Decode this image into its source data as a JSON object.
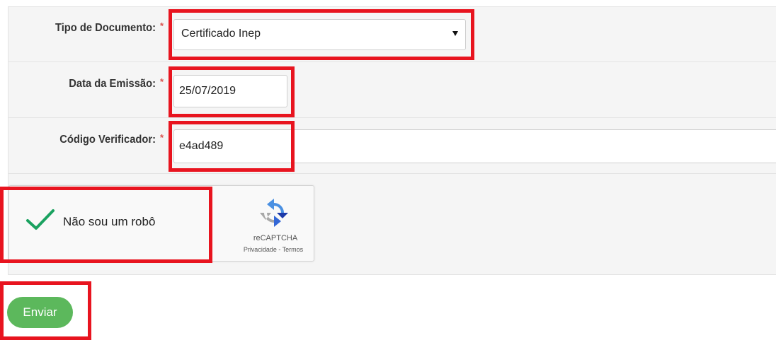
{
  "form": {
    "document_type": {
      "label": "Tipo de Documento:",
      "required_mark": "*",
      "selected": "Certificado Inep"
    },
    "issue_date": {
      "label": "Data da Emissão:",
      "required_mark": "*",
      "value": "25/07/2019"
    },
    "verification_code": {
      "label": "Código Verificador:",
      "required_mark": "*",
      "value": "e4ad489"
    }
  },
  "captcha": {
    "label": "Não sou um robô",
    "checked": true,
    "brand": "reCAPTCHA",
    "links": "Privacidade - Termos",
    "check_icon": "checkmark-icon",
    "logo_icon": "recaptcha-logo-icon"
  },
  "actions": {
    "submit_label": "Enviar"
  },
  "colors": {
    "highlight": "#e8141f",
    "submit_button": "#5cb85c",
    "required_mark": "#d9534f",
    "checkmark": "#1aa260"
  }
}
